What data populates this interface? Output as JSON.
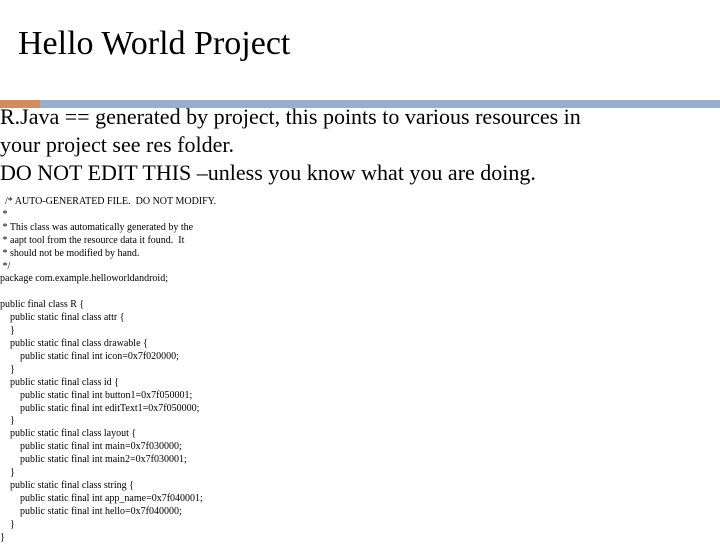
{
  "title": "Hello World Project",
  "colors": {
    "accent": "#d58b5e",
    "divider": "#97aecf"
  },
  "body_lines": [
    "R.Java == generated by project, this points to various resources in",
    "your project see res folder.",
    "DO NOT EDIT THIS –unless you know what you are doing."
  ],
  "code_lines": [
    "  /* AUTO-GENERATED FILE.  DO NOT MODIFY.",
    " *",
    " * This class was automatically generated by the",
    " * aapt tool from the resource data it found.  It",
    " * should not be modified by hand.",
    " */",
    "package com.example.helloworldandroid;",
    "",
    "public final class R {",
    "    public static final class attr {",
    "    }",
    "    public static final class drawable {",
    "        public static final int icon=0x7f020000;",
    "    }",
    "    public static final class id {",
    "        public static final int button1=0x7f050001;",
    "        public static final int editText1=0x7f050000;",
    "    }",
    "    public static final class layout {",
    "        public static final int main=0x7f030000;",
    "        public static final int main2=0x7f030001;",
    "    }",
    "    public static final class string {",
    "        public static final int app_name=0x7f040001;",
    "        public static final int hello=0x7f040000;",
    "    }",
    "}"
  ]
}
